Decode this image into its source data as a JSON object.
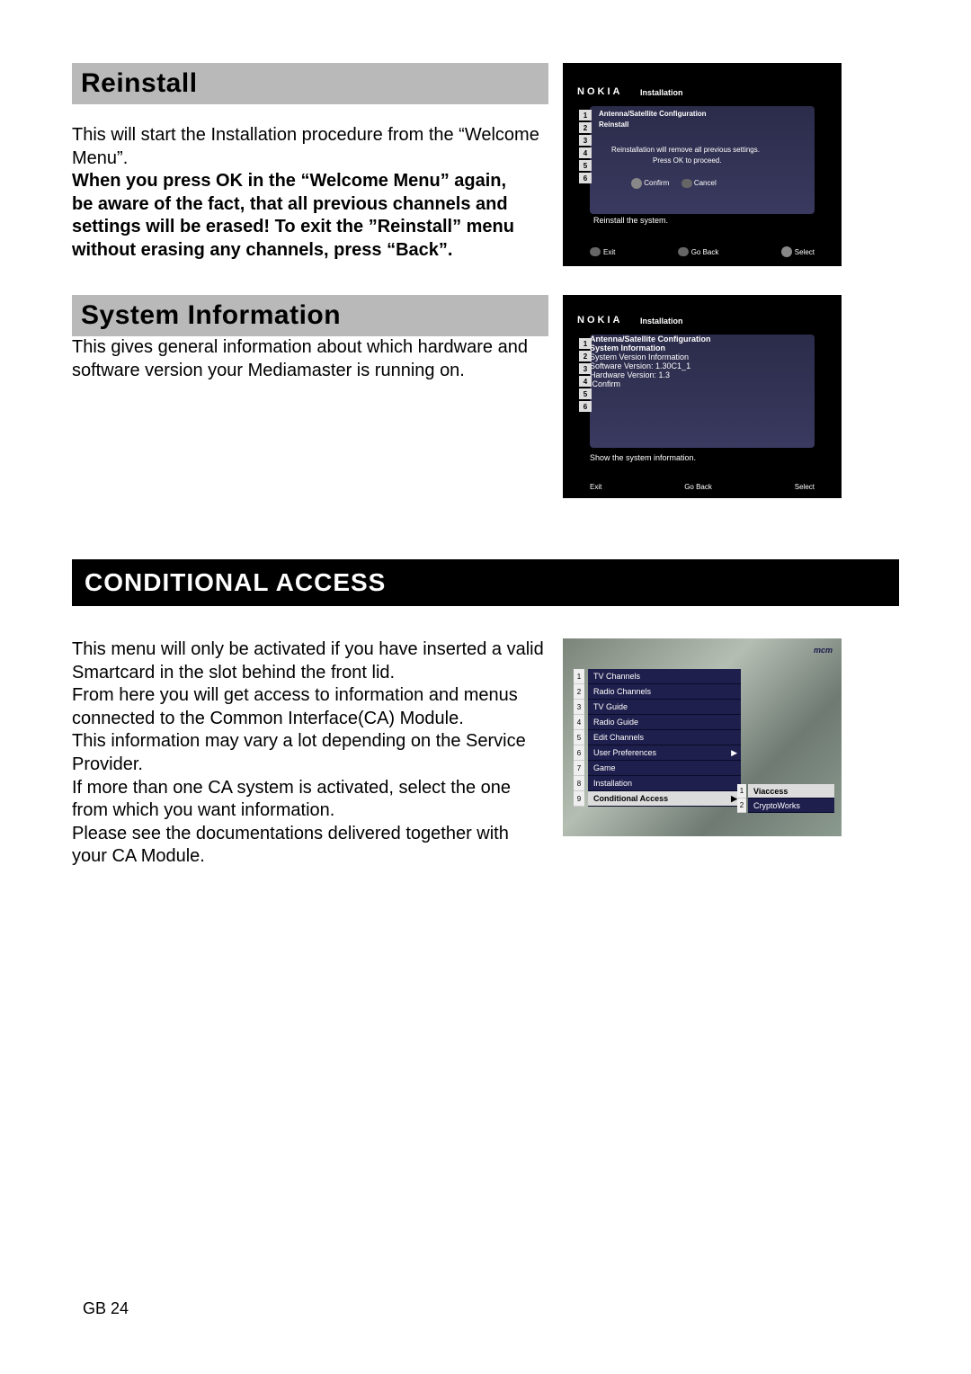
{
  "sections": {
    "reinstall": {
      "title": "Reinstall",
      "p1": "This will start the Installation procedure from the “Welcome Menu”.",
      "p2": "When you press OK in the “Welcome Menu” again,",
      "p3": "be aware of the fact, that all previous channels and settings will be erased! To exit the ”Reinstall” menu without erasing any channels, press “Back”."
    },
    "sysinfo": {
      "title": "System Information",
      "p1": "This gives general information about which hardware and software version your Mediamaster is running on."
    },
    "condaccess": {
      "title": "CONDITIONAL ACCESS",
      "p1": "This menu will only be activated if you have inserted a valid Smartcard in the slot behind the front lid.",
      "p2": "From here you will get access to information and menus connected to the Common Interface(CA) Module.",
      "p3": "This information may vary a lot depending on the Service Provider.",
      "p4": "If more than one CA system is activated, select the one from which you want information.",
      "p5": "Please see the documentations delivered together with your CA Module."
    }
  },
  "footer": "GB 24",
  "screenshot1": {
    "brand": "NOKIA",
    "header": "Installation",
    "panel_title": "Antenna/Satellite Configuration",
    "highlight": "Reinstall",
    "msg1": "Reinstallation will remove all previous settings.",
    "msg2": "Press OK to proceed.",
    "confirm": "Confirm",
    "cancel": "Cancel",
    "prompt": "Reinstall the system.",
    "exit": "Exit",
    "goback": "Go Back",
    "select": "Select",
    "nums": [
      "1",
      "2",
      "3",
      "4",
      "5",
      "6"
    ]
  },
  "screenshot2": {
    "brand": "NOKIA",
    "header": "Installation",
    "panel_title": "Antenna/Satellite Configuration",
    "highlight": "System Information",
    "line1": "System Version Information",
    "line2": "Software Version: 1.30C1_1",
    "line3": "Hardware Version: 1.3",
    "confirm": "Confirm",
    "prompt": "Show the system information.",
    "exit": "Exit",
    "goback": "Go Back",
    "select": "Select",
    "nums": [
      "1",
      "2",
      "3",
      "4",
      "5",
      "6"
    ]
  },
  "screenshot3": {
    "topbrand": "mcm",
    "menu": [
      "TV Channels",
      "Radio Channels",
      "TV Guide",
      "Radio Guide",
      "Edit Channels",
      "User Preferences",
      "Game",
      "Installation",
      "Conditional Access"
    ],
    "submenu": [
      "Viaccess",
      "CryptoWorks"
    ],
    "idx": [
      "1",
      "2",
      "3",
      "4",
      "5",
      "6",
      "7",
      "8",
      "9"
    ],
    "subidx": [
      "1",
      "2"
    ],
    "arrow": "▶"
  }
}
